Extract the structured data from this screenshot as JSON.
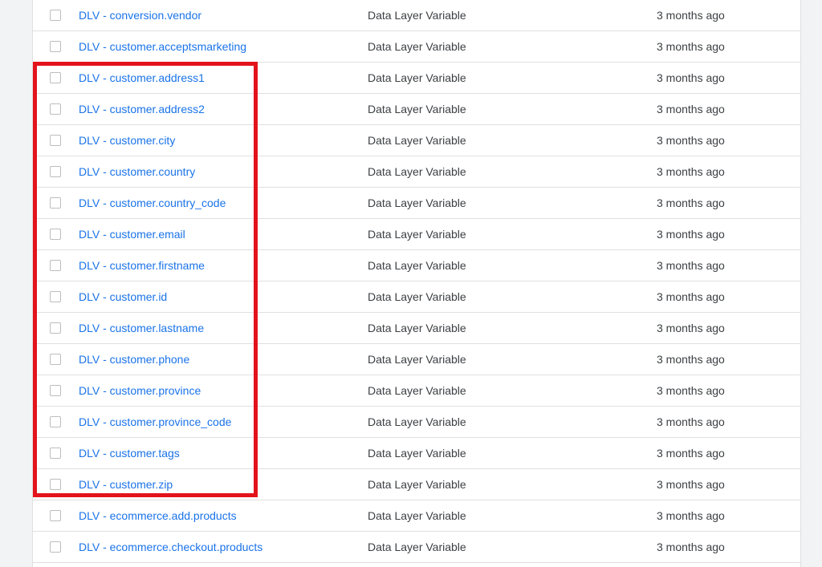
{
  "variables_table": {
    "rows": [
      {
        "name": "DLV - conversion.vendor",
        "type": "Data Layer Variable",
        "last_edited": "3 months ago"
      },
      {
        "name": "DLV - customer.acceptsmarketing",
        "type": "Data Layer Variable",
        "last_edited": "3 months ago"
      },
      {
        "name": "DLV - customer.address1",
        "type": "Data Layer Variable",
        "last_edited": "3 months ago"
      },
      {
        "name": "DLV - customer.address2",
        "type": "Data Layer Variable",
        "last_edited": "3 months ago"
      },
      {
        "name": "DLV - customer.city",
        "type": "Data Layer Variable",
        "last_edited": "3 months ago"
      },
      {
        "name": "DLV - customer.country",
        "type": "Data Layer Variable",
        "last_edited": "3 months ago"
      },
      {
        "name": "DLV - customer.country_code",
        "type": "Data Layer Variable",
        "last_edited": "3 months ago"
      },
      {
        "name": "DLV - customer.email",
        "type": "Data Layer Variable",
        "last_edited": "3 months ago"
      },
      {
        "name": "DLV - customer.firstname",
        "type": "Data Layer Variable",
        "last_edited": "3 months ago"
      },
      {
        "name": "DLV - customer.id",
        "type": "Data Layer Variable",
        "last_edited": "3 months ago"
      },
      {
        "name": "DLV - customer.lastname",
        "type": "Data Layer Variable",
        "last_edited": "3 months ago"
      },
      {
        "name": "DLV - customer.phone",
        "type": "Data Layer Variable",
        "last_edited": "3 months ago"
      },
      {
        "name": "DLV - customer.province",
        "type": "Data Layer Variable",
        "last_edited": "3 months ago"
      },
      {
        "name": "DLV - customer.province_code",
        "type": "Data Layer Variable",
        "last_edited": "3 months ago"
      },
      {
        "name": "DLV - customer.tags",
        "type": "Data Layer Variable",
        "last_edited": "3 months ago"
      },
      {
        "name": "DLV - customer.zip",
        "type": "Data Layer Variable",
        "last_edited": "3 months ago"
      },
      {
        "name": "DLV - ecommerce.add.products",
        "type": "Data Layer Variable",
        "last_edited": "3 months ago"
      },
      {
        "name": "DLV - ecommerce.checkout.products",
        "type": "Data Layer Variable",
        "last_edited": "3 months ago"
      }
    ]
  },
  "colors": {
    "link": "#1a73e8",
    "text": "#3c4043",
    "highlight_box": "#e3131b",
    "background": "#f1f3f4"
  }
}
